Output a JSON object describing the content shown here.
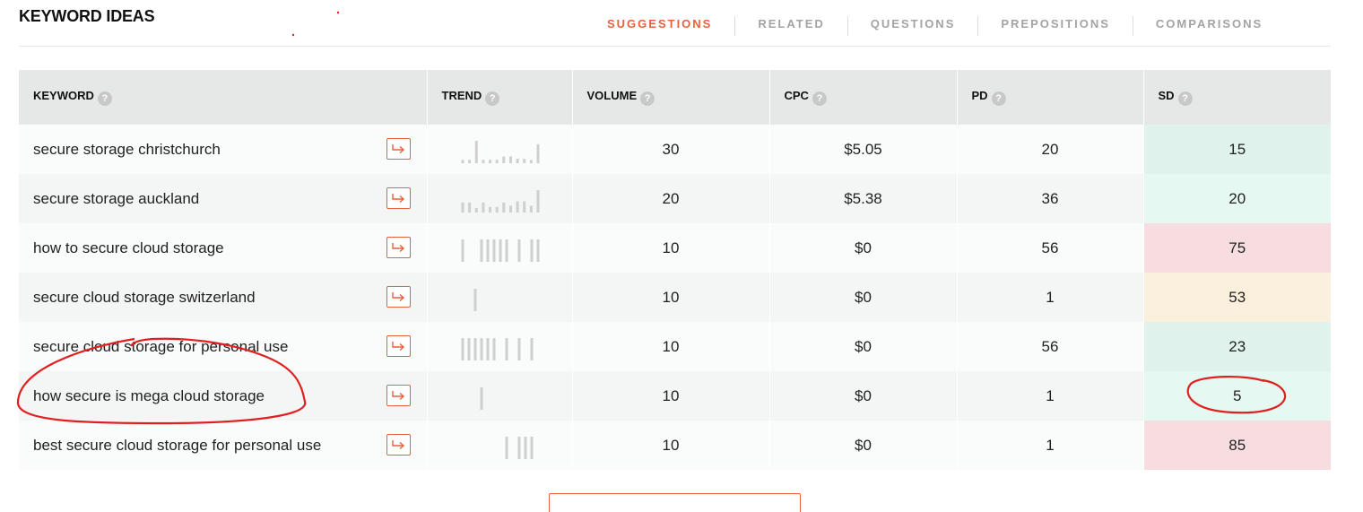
{
  "title": "KEYWORD IDEAS",
  "tabs": [
    {
      "label": "SUGGESTIONS",
      "active": true
    },
    {
      "label": "RELATED",
      "active": false
    },
    {
      "label": "QUESTIONS",
      "active": false
    },
    {
      "label": "PREPOSITIONS",
      "active": false
    },
    {
      "label": "COMPARISONS",
      "active": false
    }
  ],
  "columns": {
    "keyword": "KEYWORD",
    "trend": "TREND",
    "volume": "VOLUME",
    "cpc": "CPC",
    "pd": "PD",
    "sd": "SD"
  },
  "help_glyph": "?",
  "colors": {
    "accent": "#e8613c",
    "header_bg": "#e6e8e8",
    "sd_low": "#dff3ec",
    "sd_medium": "#fbf0dd",
    "sd_high": "#f7dde0",
    "annotation": "#e0201e"
  },
  "icons": {
    "row_action": "arrow-return-right-icon",
    "help": "question-circle-icon"
  },
  "rows": [
    {
      "keyword": "secure storage christchurch",
      "volume": "30",
      "cpc": "$5.05",
      "pd": "20",
      "sd": "15",
      "sd_level": "c-green",
      "trend": [
        0.15,
        0.15,
        1,
        0.15,
        0.15,
        0.15,
        0.3,
        0.3,
        0.2,
        0.2,
        0.15,
        0.85
      ]
    },
    {
      "keyword": "secure storage auckland",
      "volume": "20",
      "cpc": "$5.38",
      "pd": "36",
      "sd": "20",
      "sd_level": "c-mint",
      "trend": [
        0.45,
        0.45,
        0.2,
        0.45,
        0.25,
        0.25,
        0.45,
        0.3,
        0.5,
        0.5,
        0.3,
        1
      ]
    },
    {
      "keyword": "how to secure cloud storage",
      "volume": "10",
      "cpc": "$0",
      "pd": "56",
      "sd": "75",
      "sd_level": "c-red",
      "trend": [
        1,
        0,
        0,
        1,
        1,
        1,
        1,
        1,
        0,
        1,
        0,
        1,
        1
      ]
    },
    {
      "keyword": "secure cloud storage switzerland",
      "volume": "10",
      "cpc": "$0",
      "pd": "1",
      "sd": "53",
      "sd_level": "c-amber",
      "trend": [
        0,
        0,
        1,
        0,
        0,
        0,
        0,
        0,
        0,
        0,
        0,
        0,
        0
      ]
    },
    {
      "keyword": "secure cloud storage for personal use",
      "volume": "10",
      "cpc": "$0",
      "pd": "56",
      "sd": "23",
      "sd_level": "c-green",
      "trend": [
        1,
        1,
        1,
        1,
        1,
        1,
        0,
        1,
        0,
        1,
        0,
        1,
        0
      ]
    },
    {
      "keyword": "how secure is mega cloud storage",
      "volume": "10",
      "cpc": "$0",
      "pd": "1",
      "sd": "5",
      "sd_level": "c-mint",
      "trend": [
        0,
        0,
        0,
        1,
        0,
        0,
        0,
        0,
        0,
        0,
        0,
        0,
        0
      ]
    },
    {
      "keyword": "best secure cloud storage for personal use",
      "volume": "10",
      "cpc": "$0",
      "pd": "1",
      "sd": "85",
      "sd_level": "c-red",
      "trend": [
        0,
        0,
        0,
        0,
        0,
        0,
        0,
        1,
        0,
        1,
        1,
        1,
        0
      ]
    }
  ]
}
